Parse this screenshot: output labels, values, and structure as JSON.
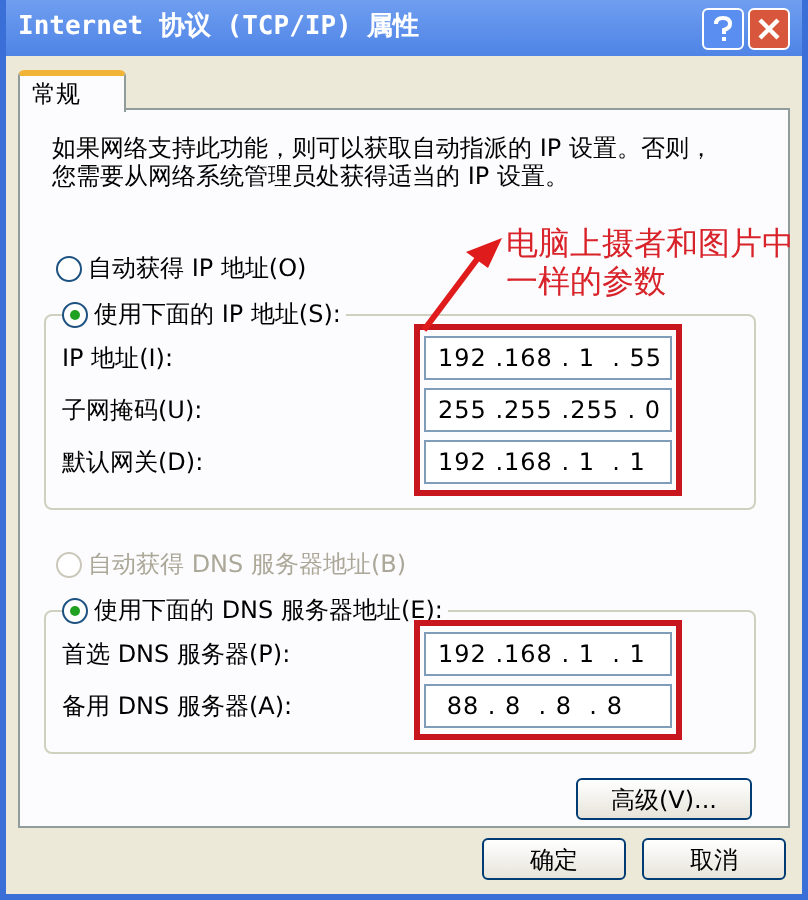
{
  "window": {
    "title": "Internet 协议 (TCP/IP) 属性"
  },
  "tabs": [
    {
      "label": "常规",
      "selected": true
    }
  ],
  "description": "如果网络支持此功能，则可以获取自动指派的 IP 设置。否则，您需要从网络系统管理员处获得适当的 IP 设置。",
  "ip_options": [
    {
      "label": "自动获得 IP 地址(O)",
      "selected": false,
      "disabled": false
    },
    {
      "label": "使用下面的 IP 地址(S):",
      "selected": true,
      "disabled": false
    }
  ],
  "ip_fields": [
    {
      "label": "IP 地址(I):",
      "value": "192 .168 . 1  . 55"
    },
    {
      "label": "子网掩码(U):",
      "value": "255 .255 .255 . 0"
    },
    {
      "label": "默认网关(D):",
      "value": "192 .168 . 1  . 1"
    }
  ],
  "dns_options": [
    {
      "label": "自动获得 DNS 服务器地址(B)",
      "selected": false,
      "disabled": true
    },
    {
      "label": "使用下面的 DNS 服务器地址(E):",
      "selected": true,
      "disabled": false
    }
  ],
  "dns_fields": [
    {
      "label": "首选 DNS 服务器(P):",
      "value": "192 .168 . 1  . 1"
    },
    {
      "label": "备用 DNS 服务器(A):",
      "value": " 88 . 8  . 8  . 8"
    }
  ],
  "advanced_button": "高级(V)...",
  "buttons": [
    "确定",
    "取消"
  ],
  "annotation": {
    "text": "电脑上摄者和图片中一样的参数"
  }
}
